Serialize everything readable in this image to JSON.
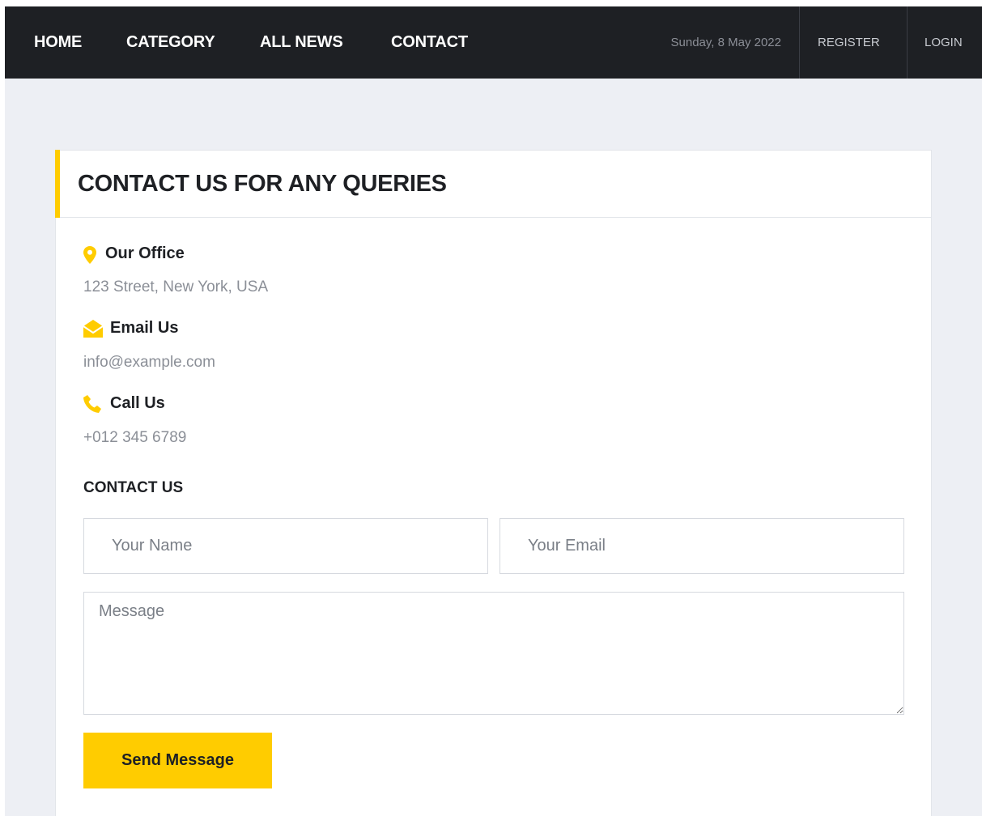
{
  "nav": {
    "items": [
      {
        "label": "HOME"
      },
      {
        "label": "CATEGORY"
      },
      {
        "label": "ALL NEWS"
      },
      {
        "label": "CONTACT"
      }
    ],
    "date": "Sunday, 8 May 2022",
    "register_label": "REGISTER",
    "login_label": "LOGIN"
  },
  "contact": {
    "title": "CONTACT US FOR ANY QUERIES",
    "office_label": "Our Office",
    "office_value": "123 Street, New York, USA",
    "email_label": "Email Us",
    "email_value": "info@example.com",
    "call_label": "Call Us",
    "call_value": "+012 345 6789",
    "form_title": "CONTACT US",
    "name_placeholder": "Your Name",
    "email_placeholder": "Your Email",
    "message_placeholder": "Message",
    "send_label": "Send Message"
  },
  "colors": {
    "accent": "#ffcc00",
    "nav_background": "#1e2024",
    "page_background": "#edeff4"
  },
  "icons": {
    "office": "map-marker-icon",
    "email": "envelope-open-icon",
    "call": "phone-icon"
  }
}
